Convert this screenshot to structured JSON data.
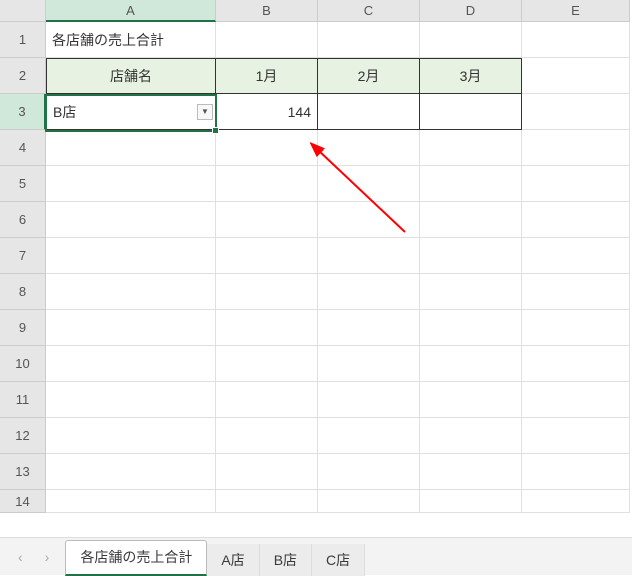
{
  "columns": [
    "A",
    "B",
    "C",
    "D",
    "E"
  ],
  "rows": [
    "1",
    "2",
    "3",
    "4",
    "5",
    "6",
    "7",
    "8",
    "9",
    "10",
    "11",
    "12",
    "13",
    "14"
  ],
  "active_column": "A",
  "active_row": "3",
  "cells": {
    "title": "各店舗の売上合計",
    "headers": {
      "store": "店舗名",
      "m1": "1月",
      "m2": "2月",
      "m3": "3月"
    },
    "data": {
      "store_name": "B店",
      "v1": "144",
      "v2": "",
      "v3": ""
    }
  },
  "tabs": {
    "nav_prev": "‹",
    "nav_next": "›",
    "items": [
      "各店舗の売上合計",
      "A店",
      "B店",
      "C店"
    ],
    "active_index": 0
  }
}
